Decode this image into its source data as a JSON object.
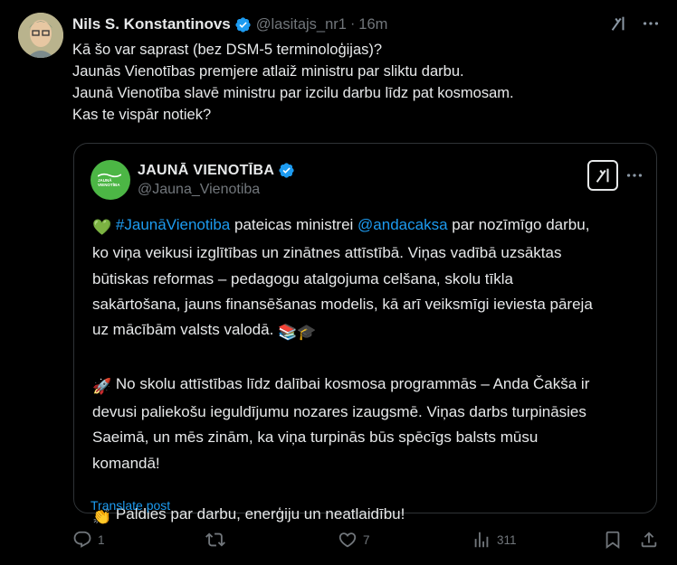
{
  "tweet": {
    "author_name": "Nils S. Konstantinovs",
    "author_handle": "@lasitajs_nr1",
    "separator": "·",
    "time": "16m",
    "text_lines": [
      "Kā šo var saprast (bez DSM-5 terminoloģijas)?",
      "Jaunās Vienotības premjere atlaiž ministru par sliktu darbu.",
      "Jaunā Vienotība slavē ministru par izcilu darbu līdz pat kosmosam.",
      "Kas te vispār notiek?"
    ]
  },
  "quote": {
    "author_name": "JAUNĀ VIENOTĪBA",
    "author_handle": "@Jauna_Vienotiba",
    "avatar_text": [
      "JAUNĀ",
      "VIENOTĪBA"
    ],
    "p1": {
      "emoji": "💚",
      "hashtag": "#JaunāVienotiba",
      "t1": " pateicas ministrei ",
      "mention": "@andacaksa",
      "t2": " par nozīmīgo darbu,",
      "lines": [
        "ko viņa veikusi izglītības un zinātnes attīstībā. Viņas vadībā uzsāktas",
        "būtiskas reformas – pedagogu atalgojuma celšana, skolu tīkla",
        "sakārtošana, jauns finansēšanas modelis, kā arī veiksmīgi ieviesta pāreja",
        "uz mācībām valsts valodā."
      ],
      "end_emoji": "📚🎓"
    },
    "p2": {
      "emoji": "🚀",
      "first": " No skolu attīstības līdz dalībai kosmosa programmās – Anda Čakša ir",
      "lines": [
        "devusi paliekošu ieguldījumu nozares izaugsmē. Viņas darbs turpināsies",
        "Saeimā, un mēs zinām, ka viņa turpinās būs spēcīgs balsts mūsu",
        "komandā!"
      ]
    },
    "p3": {
      "emoji": "👏",
      "text": " Paldies par darbu, enerģiju un neatlaidību!"
    },
    "translate": "Translate post"
  },
  "actions": {
    "replies": "1",
    "reposts": "",
    "likes": "7",
    "views": "311"
  },
  "colors": {
    "background": "#000000",
    "text": "#e7e9ea",
    "muted": "#71767b",
    "accent": "#1d9bf0",
    "border": "#2f3336",
    "brand_green": "#4cb645"
  }
}
